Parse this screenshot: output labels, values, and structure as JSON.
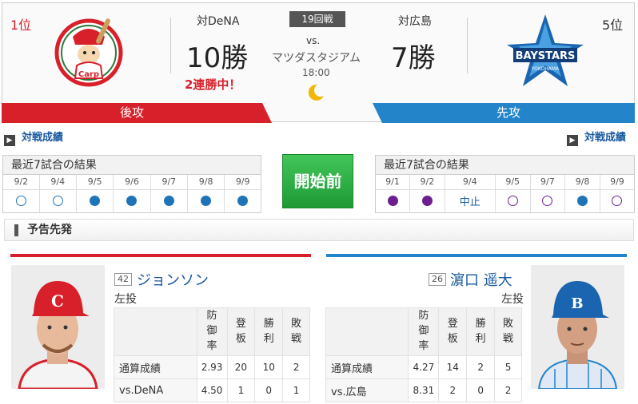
{
  "home": {
    "rank": "1位",
    "wins_label": "対DeNA",
    "wins": "10勝",
    "streak": "2連勝中！",
    "order": "後攻",
    "logo_text": "Carp",
    "color": "#d8202a"
  },
  "away": {
    "rank": "5位",
    "wins_label": "対広島",
    "wins": "7勝",
    "order": "先攻",
    "logo_text": "BAYSTARS",
    "logo_sub": "YOKOHAMA",
    "color": "#2384c9"
  },
  "match": {
    "game_no": "19回戦",
    "vs": "vs.",
    "stadium": "マツダスタジアム",
    "time": "18:00",
    "night_icon": "moon-star-icon"
  },
  "links": {
    "home_h2h": "対戦成績",
    "away_h2h": "対戦成績"
  },
  "recent_home": {
    "title": "最近7試合の結果",
    "dates": [
      "9/2",
      "9/4",
      "9/5",
      "9/6",
      "9/7",
      "9/8",
      "9/9"
    ],
    "results": [
      "lose",
      "lose",
      "win",
      "win",
      "win",
      "win",
      "win"
    ]
  },
  "recent_away": {
    "title": "最近7試合の結果",
    "dates": [
      "9/1",
      "9/2",
      "9/4",
      "9/5",
      "9/7",
      "9/8",
      "9/9"
    ],
    "results": [
      "purple",
      "purple",
      "cancel",
      "plose",
      "plose",
      "win",
      "plose"
    ],
    "cancel_label": "中止"
  },
  "start_button": "開始前",
  "probable_label": "予告先発",
  "stat_headers": [
    "防御率",
    "登板",
    "勝利",
    "敗戦"
  ],
  "home_pitcher": {
    "number": "42",
    "name": "ジョンソン",
    "hand": "左投",
    "rows": [
      {
        "label": "通算成績",
        "era": "2.93",
        "g": "20",
        "w": "10",
        "l": "2"
      },
      {
        "label": "vs.DeNA",
        "era": "4.50",
        "g": "1",
        "w": "0",
        "l": "1"
      }
    ]
  },
  "away_pitcher": {
    "number": "26",
    "name": "濵口 遥大",
    "hand": "左投",
    "rows": [
      {
        "label": "通算成績",
        "era": "4.27",
        "g": "14",
        "w": "2",
        "l": "5"
      },
      {
        "label": "vs.広島",
        "era": "8.31",
        "g": "2",
        "w": "0",
        "l": "2"
      }
    ]
  }
}
